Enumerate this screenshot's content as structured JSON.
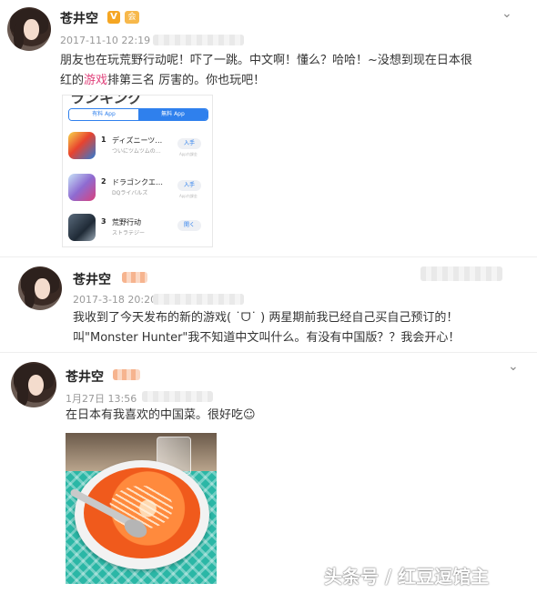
{
  "posts": [
    {
      "username": "苍井空",
      "v_badge": "V",
      "vip_badge": "会",
      "time": "2017-11-10 22:19",
      "text_line1_a": "朋友也在玩荒野行动呢！吓了一跳。中文啊！懂么？哈哈！~没想到现在日本很",
      "text_line2_a": "红的",
      "text_line2_highlight": "游戏",
      "text_line2_b": "排第三名 厉害的。你也玩吧！",
      "store": {
        "title": "ランキング",
        "tabs": [
          "有料 App",
          "無料 App"
        ],
        "apps": [
          {
            "rank": "1",
            "name": "ディズニーツ…",
            "sub": "ついにツムツムの…",
            "button": "入手",
            "iap": "App内課金"
          },
          {
            "rank": "2",
            "name": "ドラゴンクエ…",
            "sub": "DQライバルズ",
            "button": "入手",
            "iap": "App内課金"
          },
          {
            "rank": "3",
            "name": "荒野行动",
            "sub": "ストラテジー",
            "button": "開く",
            "iap": ""
          }
        ]
      }
    },
    {
      "username": "苍井空",
      "time": "2017-3-18 20:20",
      "text_line1": "我收到了今天发布的新的游戏( ˙ᗜ˙ )  两星期前我已经自己买自己预订的！",
      "text_line2": "叫\"Monster Hunter\"我不知道中文叫什么。有没有中国版？？我会开心！"
    },
    {
      "username": "苍井空",
      "time": "1月27日 13:56",
      "text_line1": "在日本有我喜欢的中国菜。很好吃☺"
    }
  ],
  "watermark": "头条号 / 红豆逗馆主",
  "icons": {
    "expand": "chevron-down-icon"
  },
  "colors": {
    "highlight": "#e0407a",
    "accent": "#2f80ed",
    "badge": "#f5a623"
  }
}
